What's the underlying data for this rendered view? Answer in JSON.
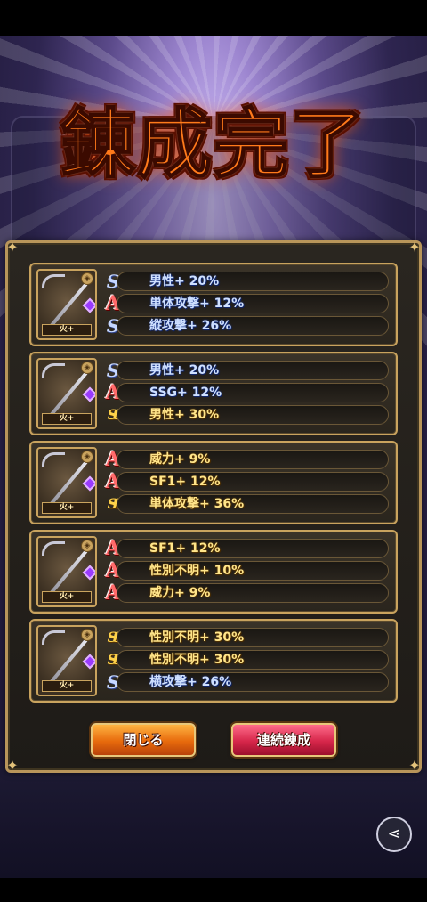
{
  "title": "錬成完了",
  "cards": [
    {
      "element": "火+",
      "lines": [
        {
          "icon": "S",
          "text": "男性+ 20%",
          "color": "blue"
        },
        {
          "icon": "A",
          "text": "単体攻撃+ 12%",
          "color": "blue"
        },
        {
          "icon": "S",
          "text": "縦攻撃+ 26%",
          "color": "blue"
        }
      ]
    },
    {
      "element": "火+",
      "lines": [
        {
          "icon": "S",
          "text": "男性+ 20%",
          "color": "blue"
        },
        {
          "icon": "A",
          "text": "SSG+ 12%",
          "color": "blue"
        },
        {
          "icon": "SS",
          "text": "男性+ 30%",
          "color": "gold"
        }
      ]
    },
    {
      "element": "火+",
      "lines": [
        {
          "icon": "A",
          "text": "威力+ 9%",
          "color": "gold"
        },
        {
          "icon": "A",
          "text": "SF1+ 12%",
          "color": "gold"
        },
        {
          "icon": "SS",
          "text": "単体攻撃+ 36%",
          "color": "gold"
        }
      ]
    },
    {
      "element": "火+",
      "lines": [
        {
          "icon": "A",
          "text": "SF1+ 12%",
          "color": "gold"
        },
        {
          "icon": "A",
          "text": "性別不明+ 10%",
          "color": "gold"
        },
        {
          "icon": "A",
          "text": "威力+ 9%",
          "color": "gold"
        }
      ]
    },
    {
      "element": "火+",
      "lines": [
        {
          "icon": "SS",
          "text": "性別不明+ 30%",
          "color": "gold"
        },
        {
          "icon": "SS",
          "text": "性別不明+ 30%",
          "color": "gold"
        },
        {
          "icon": "S",
          "text": "横攻撃+ 26%",
          "color": "blue"
        }
      ]
    }
  ],
  "buttons": {
    "close": "閉じる",
    "continuous": "連続錬成"
  },
  "share_icon": "share-icon",
  "icons": {
    "S": "S",
    "A": "A",
    "SS": "SS"
  }
}
